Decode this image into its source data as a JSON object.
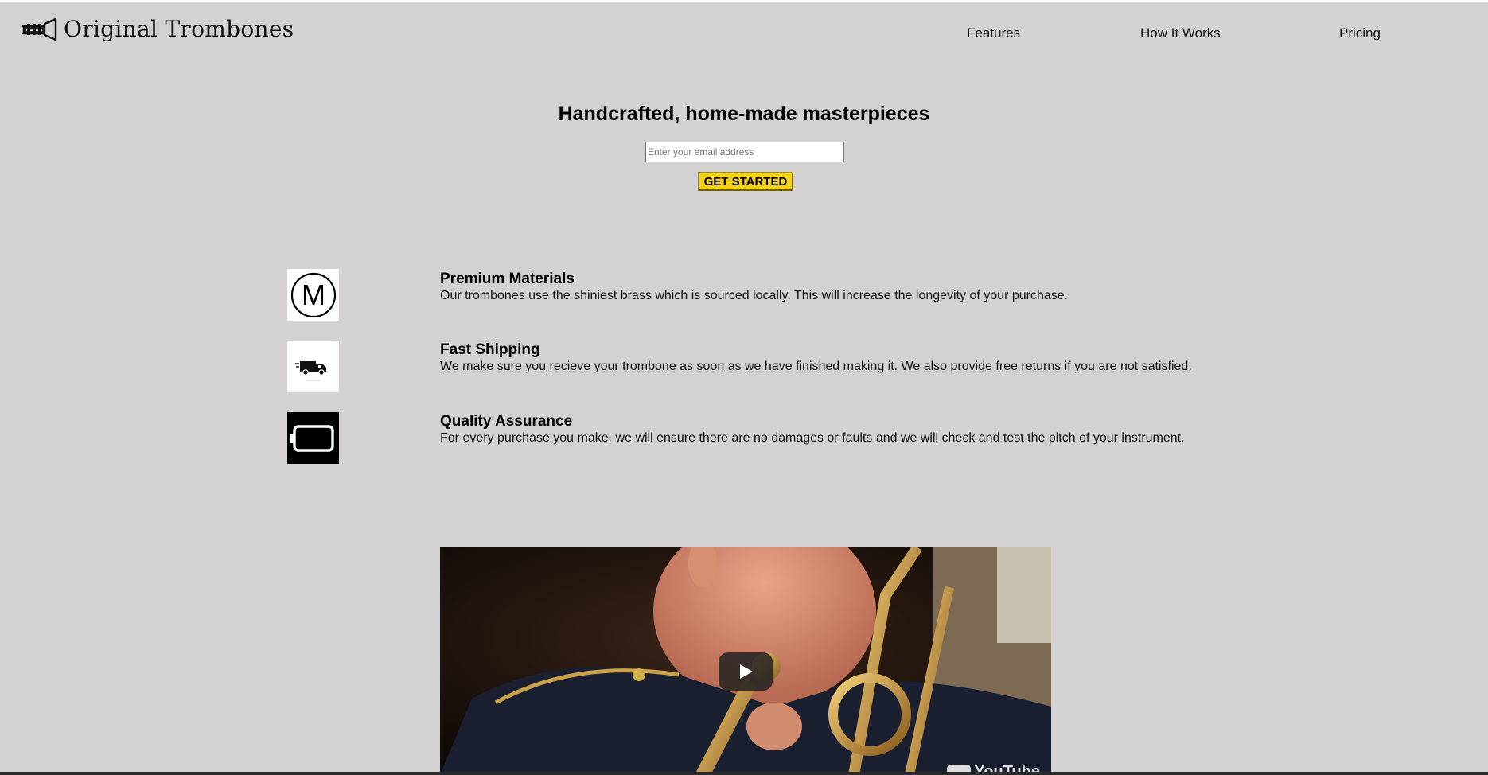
{
  "brand": {
    "name": "Original Trombones",
    "logo_icon": "trumpet-logo-icon"
  },
  "nav": {
    "items": [
      {
        "label": "Features"
      },
      {
        "label": "How It Works"
      },
      {
        "label": "Pricing"
      }
    ]
  },
  "hero": {
    "title": "Handcrafted, home-made masterpieces",
    "email_placeholder": "Enter your email address",
    "cta_label": "GET STARTED"
  },
  "features": [
    {
      "icon": "medal-m-icon",
      "title": "Premium Materials",
      "description": "Our trombones use the shiniest brass which is sourced locally. This will increase the longevity of your purchase."
    },
    {
      "icon": "truck-icon",
      "title": "Fast Shipping",
      "description": "We make sure you recieve your trombone as soon as we have finished making it. We also provide free returns if you are not satisfied."
    },
    {
      "icon": "battery-icon",
      "title": "Quality Assurance",
      "description": "For every purchase you make, we will ensure there are no damages or faults and we will check and test the pitch of your instrument."
    }
  ],
  "video": {
    "provider_label": "YouTube",
    "play_icon": "play-icon"
  },
  "colors": {
    "background": "#d3d1d2",
    "cta": "#f4d21a"
  }
}
